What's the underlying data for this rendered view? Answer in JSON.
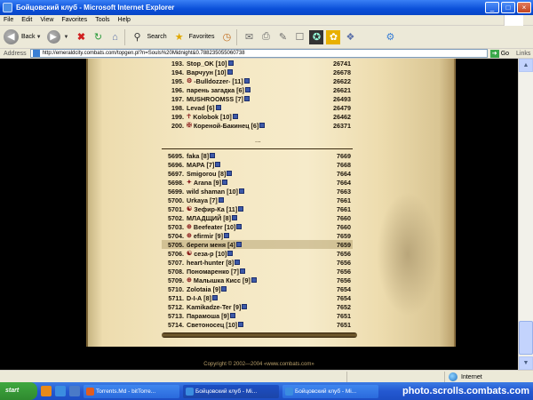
{
  "window": {
    "title": "Бойцовский клуб - Microsoft Internet Explorer",
    "buttons": [
      "_",
      "□",
      "×"
    ]
  },
  "menu": [
    "File",
    "Edit",
    "View",
    "Favorites",
    "Tools",
    "Help"
  ],
  "toolbar": {
    "back_label": "Back",
    "search_label": "Search",
    "favorites_label": "Favorites"
  },
  "address": {
    "label": "Address",
    "url": "http://emeraldcity.combats.com/topgen.pl?n=Souls%20Midnight&0.788235055060738",
    "go_label": "Go",
    "links_label": "Links"
  },
  "ranking_top": [
    {
      "rank": "193.",
      "name": "Stop_OK",
      "level": "[10]",
      "score": "26741"
    },
    {
      "rank": "194.",
      "name": "Варчуун",
      "level": "[10]",
      "score": "26678"
    },
    {
      "rank": "195.",
      "name": "-Bulldozzer-",
      "level": "[11]",
      "score": "26622",
      "clan": "⚙"
    },
    {
      "rank": "196.",
      "name": "парень загадка",
      "level": "[6]",
      "score": "26621"
    },
    {
      "rank": "197.",
      "name": "MUSHROOMSS",
      "level": "[7]",
      "score": "26493"
    },
    {
      "rank": "198.",
      "name": "Levad",
      "level": "[6]",
      "score": "26479"
    },
    {
      "rank": "199.",
      "name": "Kolobok",
      "level": "[10]",
      "score": "26462",
      "clan": "☥"
    },
    {
      "rank": "200.",
      "name": "Кореной-Бакинец",
      "level": "[6]",
      "score": "26371",
      "clan": "✠"
    }
  ],
  "ellipsis": "...",
  "ranking_bottom": [
    {
      "rank": "5695.",
      "name": "faka",
      "level": "[8]",
      "score": "7669"
    },
    {
      "rank": "5696.",
      "name": "МАРА",
      "level": "[7]",
      "score": "7668"
    },
    {
      "rank": "5697.",
      "name": "Smigorou",
      "level": "[8]",
      "score": "7664"
    },
    {
      "rank": "5698.",
      "name": "Arana",
      "level": "[9]",
      "score": "7664",
      "clan": "✦"
    },
    {
      "rank": "5699.",
      "name": "wild shaman",
      "level": "[10]",
      "score": "7663"
    },
    {
      "rank": "5700.",
      "name": "Urkaya",
      "level": "[7]",
      "score": "7661"
    },
    {
      "rank": "5701.",
      "name": "Зефир-Ка",
      "level": "[11]",
      "score": "7661",
      "clan": "☯"
    },
    {
      "rank": "5702.",
      "name": "МЛАДЩИЙ",
      "level": "[8]",
      "score": "7660"
    },
    {
      "rank": "5703.",
      "name": "Beefeater",
      "level": "[10]",
      "score": "7660",
      "clan": "⊕"
    },
    {
      "rank": "5704.",
      "name": "efirmir",
      "level": "[9]",
      "score": "7659",
      "clan": "⊕"
    },
    {
      "rank": "5705.",
      "name": "береги меня",
      "level": "[4]",
      "score": "7659",
      "highlight": true
    },
    {
      "rank": "5706.",
      "name": "сеза-р",
      "level": "[10]",
      "score": "7656",
      "clan": "☯"
    },
    {
      "rank": "5707.",
      "name": "heart-hunter",
      "level": "[8]",
      "score": "7656"
    },
    {
      "rank": "5708.",
      "name": "Пономаренко",
      "level": "[7]",
      "score": "7656"
    },
    {
      "rank": "5709.",
      "name": "Малышка Кисс",
      "level": "[9]",
      "score": "7656",
      "clan": "⊕"
    },
    {
      "rank": "5710.",
      "name": "Zolotaia",
      "level": "[9]",
      "score": "7654"
    },
    {
      "rank": "5711.",
      "name": "D-I-A",
      "level": "[8]",
      "score": "7654"
    },
    {
      "rank": "5712.",
      "name": "Kamikadze-Ter",
      "level": "[9]",
      "score": "7652"
    },
    {
      "rank": "5713.",
      "name": "Парамоша",
      "level": "[9]",
      "score": "7651"
    },
    {
      "rank": "5714.",
      "name": "Светоносец",
      "level": "[10]",
      "score": "7651"
    }
  ],
  "copyright": "Copyright © 2002—2004 «www.combats.com»",
  "status": {
    "zone_label": "Internet"
  },
  "taskbar": {
    "start_label": "start",
    "tasks": [
      {
        "label": "Torrents.Md - bitTorre...",
        "color": "#e25d1f"
      },
      {
        "label": "Бойцовский клуб - Mi...",
        "color": "#3b8de0",
        "active": true
      },
      {
        "label": "Бойцовский клуб - Mi...",
        "color": "#3b8de0"
      }
    ],
    "watermark": "photo.scrolls.combats.com"
  }
}
